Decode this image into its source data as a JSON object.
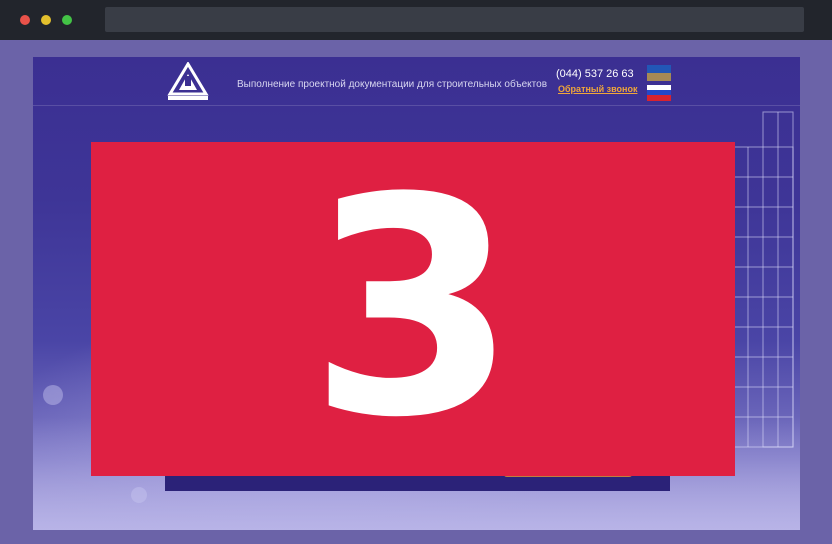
{
  "header": {
    "tagline": "Выполнение проектной документации для строительных объектов",
    "phone": "(044) 537 26 63",
    "callback": "Обратный звонок"
  },
  "languages": [
    "ua-flag",
    "ru-flag"
  ],
  "overlay": {
    "number": "3",
    "color": "#df2042"
  },
  "colors": {
    "page_bg": "#3b2f92",
    "accent": "#f0a63a"
  }
}
